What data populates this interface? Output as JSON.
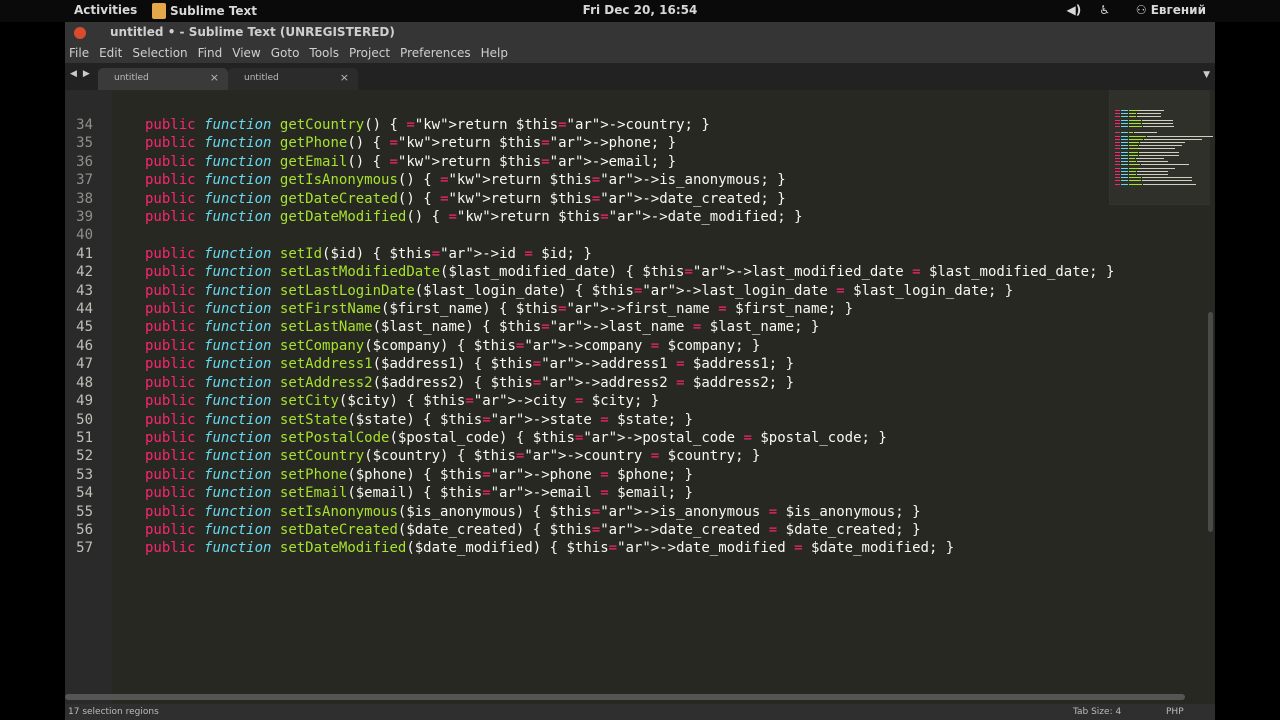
{
  "system_bar": {
    "activities": "Activities",
    "app_name": "Sublime Text",
    "clock": "Fri Dec 20, 16:54",
    "user": "Евгений"
  },
  "window": {
    "title": "untitled • - Sublime Text (UNREGISTERED)"
  },
  "menu": [
    "File",
    "Edit",
    "Selection",
    "Find",
    "View",
    "Goto",
    "Tools",
    "Project",
    "Preferences",
    "Help"
  ],
  "tabs": [
    {
      "label": "untitled",
      "close": "×",
      "active": false
    },
    {
      "label": "untitled",
      "close": "×",
      "active": true
    }
  ],
  "editor": {
    "lines": [
      {
        "num": "34",
        "name": "getCountry",
        "rest": "() { return $this->country; }"
      },
      {
        "num": "35",
        "name": "getPhone",
        "rest": "() { return $this->phone; }"
      },
      {
        "num": "36",
        "name": "getEmail",
        "rest": "() { return $this->email; }"
      },
      {
        "num": "37",
        "name": "getIsAnonymous",
        "rest": "() { return $this->is_anonymous; }"
      },
      {
        "num": "38",
        "name": "getDateCreated",
        "rest": "() { return $this->date_created; }"
      },
      {
        "num": "39",
        "name": "getDateModified",
        "rest": "() { return $this->date_modified; }"
      },
      {
        "num": "40",
        "name": "",
        "rest": ""
      },
      {
        "num": "41",
        "name": "setId",
        "rest": "($id) { $this->id = $id; }"
      },
      {
        "num": "42",
        "name": "setLastModifiedDate",
        "rest": "($last_modified_date) { $this->last_modified_date = $last_modified_date; }"
      },
      {
        "num": "43",
        "name": "setLastLoginDate",
        "rest": "($last_login_date) { $this->last_login_date = $last_login_date; }"
      },
      {
        "num": "44",
        "name": "setFirstName",
        "rest": "($first_name) { $this->first_name = $first_name; }"
      },
      {
        "num": "45",
        "name": "setLastName",
        "rest": "($last_name) { $this->last_name = $last_name; }"
      },
      {
        "num": "46",
        "name": "setCompany",
        "rest": "($company) { $this->company = $company; }"
      },
      {
        "num": "47",
        "name": "setAddress1",
        "rest": "($address1) { $this->address1 = $address1; }"
      },
      {
        "num": "48",
        "name": "setAddress2",
        "rest": "($address2) { $this->address2 = $address2; }"
      },
      {
        "num": "49",
        "name": "setCity",
        "rest": "($city) { $this->city = $city; }"
      },
      {
        "num": "50",
        "name": "setState",
        "rest": "($state) { $this->state = $state; }"
      },
      {
        "num": "51",
        "name": "setPostalCode",
        "rest": "($postal_code) { $this->postal_code = $postal_code; }"
      },
      {
        "num": "52",
        "name": "setCountry",
        "rest": "($country) { $this->country = $country; }"
      },
      {
        "num": "53",
        "name": "setPhone",
        "rest": "($phone) { $this->phone = $phone; }"
      },
      {
        "num": "54",
        "name": "setEmail",
        "rest": "($email) { $this->email = $email; }"
      },
      {
        "num": "55",
        "name": "setIsAnonymous",
        "rest": "($is_anonymous) { $this->is_anonymous = $is_anonymous; }"
      },
      {
        "num": "56",
        "name": "setDateCreated",
        "rest": "($date_created) { $this->date_created = $date_created; }"
      },
      {
        "num": "57",
        "name": "setDateModified",
        "rest": "($date_modified) { $this->date_modified = $date_modified; }"
      }
    ],
    "keyword_public": "public",
    "keyword_function": "function"
  },
  "status": {
    "left": "17 selection regions",
    "tab_size": "Tab Size: 4",
    "syntax": "PHP"
  },
  "colors": {
    "keyword": "#f92672",
    "storage": "#66d9ef",
    "function_name": "#a6e22e",
    "text": "#f8f8f2",
    "background": "#272822"
  }
}
